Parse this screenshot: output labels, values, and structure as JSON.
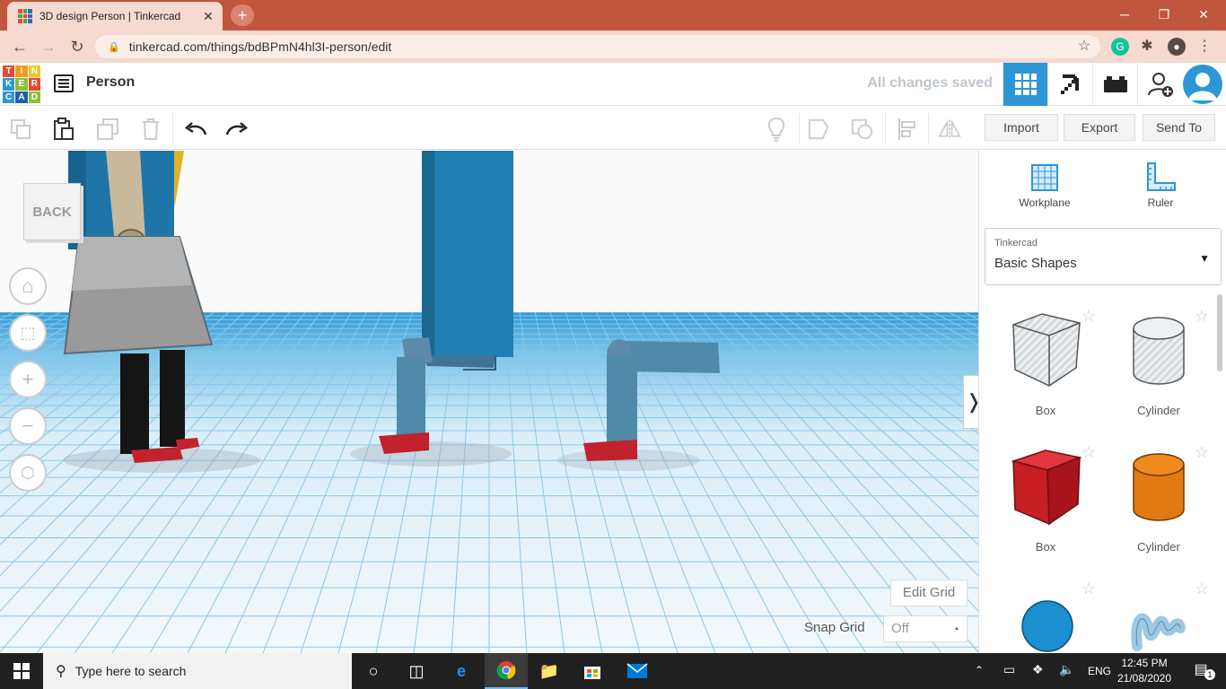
{
  "browser": {
    "tab_title": "3D design Person | Tinkercad",
    "tab_close": "✕",
    "new_tab": "+",
    "url": "tinkercad.com/things/bdBPmN4hl3I-person/edit",
    "window_controls": [
      "─",
      "❐",
      "✕"
    ]
  },
  "tinkercad": {
    "logo_letters": [
      "T",
      "I",
      "N",
      "K",
      "E",
      "R",
      "C",
      "A",
      "D"
    ],
    "logo_colors": [
      "#e2492f",
      "#f29b1d",
      "#f4c425",
      "#2d96d6",
      "#8bbf3c",
      "#e2492f",
      "#2d96d6",
      "#1e5fa8",
      "#8bbf3c"
    ],
    "project_title": "Person",
    "save_status": "All changes saved"
  },
  "toolbar": {
    "import_label": "Import",
    "export_label": "Export",
    "send_to_label": "Send To"
  },
  "viewport": {
    "back_label": "BACK",
    "edit_grid_label": "Edit Grid",
    "snap_grid_label": "Snap Grid",
    "snap_grid_value": "Off",
    "panel_toggle": "❭"
  },
  "panel": {
    "workplane_label": "Workplane",
    "ruler_label": "Ruler",
    "library_source": "Tinkercad",
    "library_name": "Basic Shapes",
    "shapes": [
      {
        "label": "Box",
        "icon": "box-hole-icon"
      },
      {
        "label": "Cylinder",
        "icon": "cylinder-hole-icon"
      },
      {
        "label": "Box",
        "icon": "box-red-icon"
      },
      {
        "label": "Cylinder",
        "icon": "cylinder-orange-icon"
      },
      {
        "label": "",
        "icon": "sphere-blue-icon"
      },
      {
        "label": "",
        "icon": "scribble-icon"
      }
    ]
  },
  "taskbar": {
    "search_placeholder": "Type here to search",
    "language": "ENG",
    "time": "12:45 PM",
    "date": "21/08/2020",
    "notification_count": "1"
  }
}
